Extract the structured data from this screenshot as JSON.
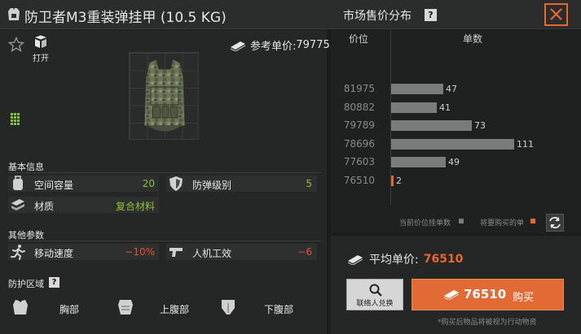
{
  "title": {
    "item_name": "防卫者M3重装弹挂甲 (10.5 KG)"
  },
  "market": {
    "title": "市场售价分布",
    "help": "?",
    "col_price": "价位",
    "col_qty": "单数"
  },
  "item": {
    "open_label": "打开",
    "ref_price_label": "参考单价:",
    "ref_price": "79775"
  },
  "basic_info": {
    "heading": "基本信息",
    "capacity_label": "空间容量",
    "capacity_value": "20",
    "armor_label": "防弹级别",
    "armor_value": "5",
    "material_label": "材质",
    "material_value": "复合材料"
  },
  "other_params": {
    "heading": "其他参数",
    "move_label": "移动速度",
    "move_value": "−10%",
    "ergo_label": "人机工效",
    "ergo_value": "−6"
  },
  "protection": {
    "heading": "防护区域",
    "help": "?",
    "zones": [
      "胸部",
      "上腹部",
      "下腹部"
    ]
  },
  "chart_data": {
    "type": "bar",
    "orientation": "horizontal",
    "title": "市场售价分布",
    "xlabel": "单数",
    "ylabel": "价位",
    "categories": [
      "81975",
      "80882",
      "79789",
      "78696",
      "77603",
      "76510"
    ],
    "values": [
      47,
      41,
      73,
      111,
      49,
      2
    ],
    "highlight_category": "76510",
    "colors": {
      "current_orders": "#7a7b7b",
      "to_buy": "#e8672f"
    }
  },
  "legend": {
    "current": "当前价位挂单数",
    "to_buy": "将要购买的单"
  },
  "buy": {
    "avg_label": "平均单价:",
    "avg_value": "76510",
    "contact_label": "联络人兑换",
    "buy_price": "76510",
    "buy_label": "购买",
    "note": "*购买后物品将被视为行动物资"
  },
  "colors": {
    "accent": "#e26a35",
    "positive": "#8fc03c",
    "negative": "#e8503a",
    "background": "#1b1c1c"
  }
}
